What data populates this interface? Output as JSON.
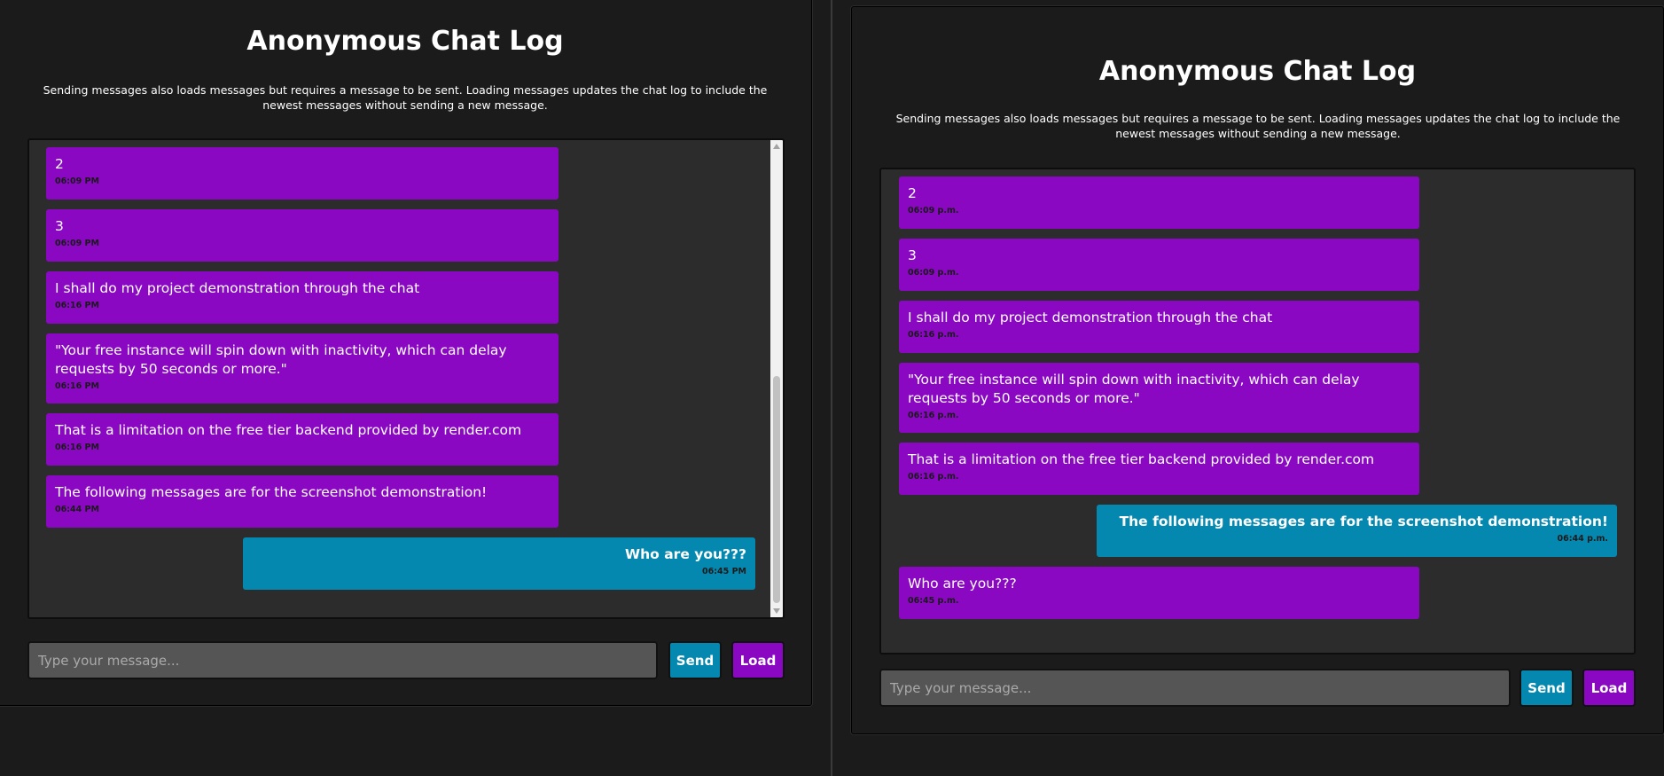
{
  "colors": {
    "page_bg": "#1b1b1b",
    "chat_bg": "#2c2c2c",
    "other_bubble": "#8a08c2",
    "own_bubble": "#0588b0",
    "input_bg": "#555555"
  },
  "left": {
    "title": "Anonymous Chat Log",
    "description": "Sending messages also loads messages but requires a message to be sent. Loading messages updates the chat log to include the newest messages without sending a new message.",
    "messages": [
      {
        "text": "2",
        "time": "06:09 PM"
      },
      {
        "text": "3",
        "time": "06:09 PM"
      },
      {
        "text": "I shall do my project demonstration through the chat",
        "time": "06:16 PM"
      },
      {
        "text": "\"Your free instance will spin down with inactivity, which can delay requests by 50 seconds or more.\"",
        "time": "06:16 PM"
      },
      {
        "text": "That is a limitation on the free tier backend provided by render.com",
        "time": "06:16 PM"
      },
      {
        "text": "The following messages are for the screenshot demonstration!",
        "time": "06:44 PM"
      },
      {
        "text": "Who are you???",
        "time": "06:45 PM"
      }
    ],
    "placeholder": "Type your message...",
    "send_label": "Send",
    "load_label": "Load"
  },
  "right": {
    "title": "Anonymous Chat Log",
    "description": "Sending messages also loads messages but requires a message to be sent. Loading messages updates the chat log to include the newest messages without sending a new message.",
    "messages": [
      {
        "text": "2",
        "time": "06:09 p.m."
      },
      {
        "text": "3",
        "time": "06:09 p.m."
      },
      {
        "text": "I shall do my project demonstration through the chat",
        "time": "06:16 p.m."
      },
      {
        "text": "\"Your free instance will spin down with inactivity, which can delay requests by 50 seconds or more.\"",
        "time": "06:16 p.m."
      },
      {
        "text": "That is a limitation on the free tier backend provided by render.com",
        "time": "06:16 p.m."
      },
      {
        "text": "The following messages are for the screenshot demonstration!",
        "time": "06:44 p.m."
      },
      {
        "text": "Who are you???",
        "time": "06:45 p.m."
      }
    ],
    "placeholder": "Type your message...",
    "send_label": "Send",
    "load_label": "Load"
  }
}
